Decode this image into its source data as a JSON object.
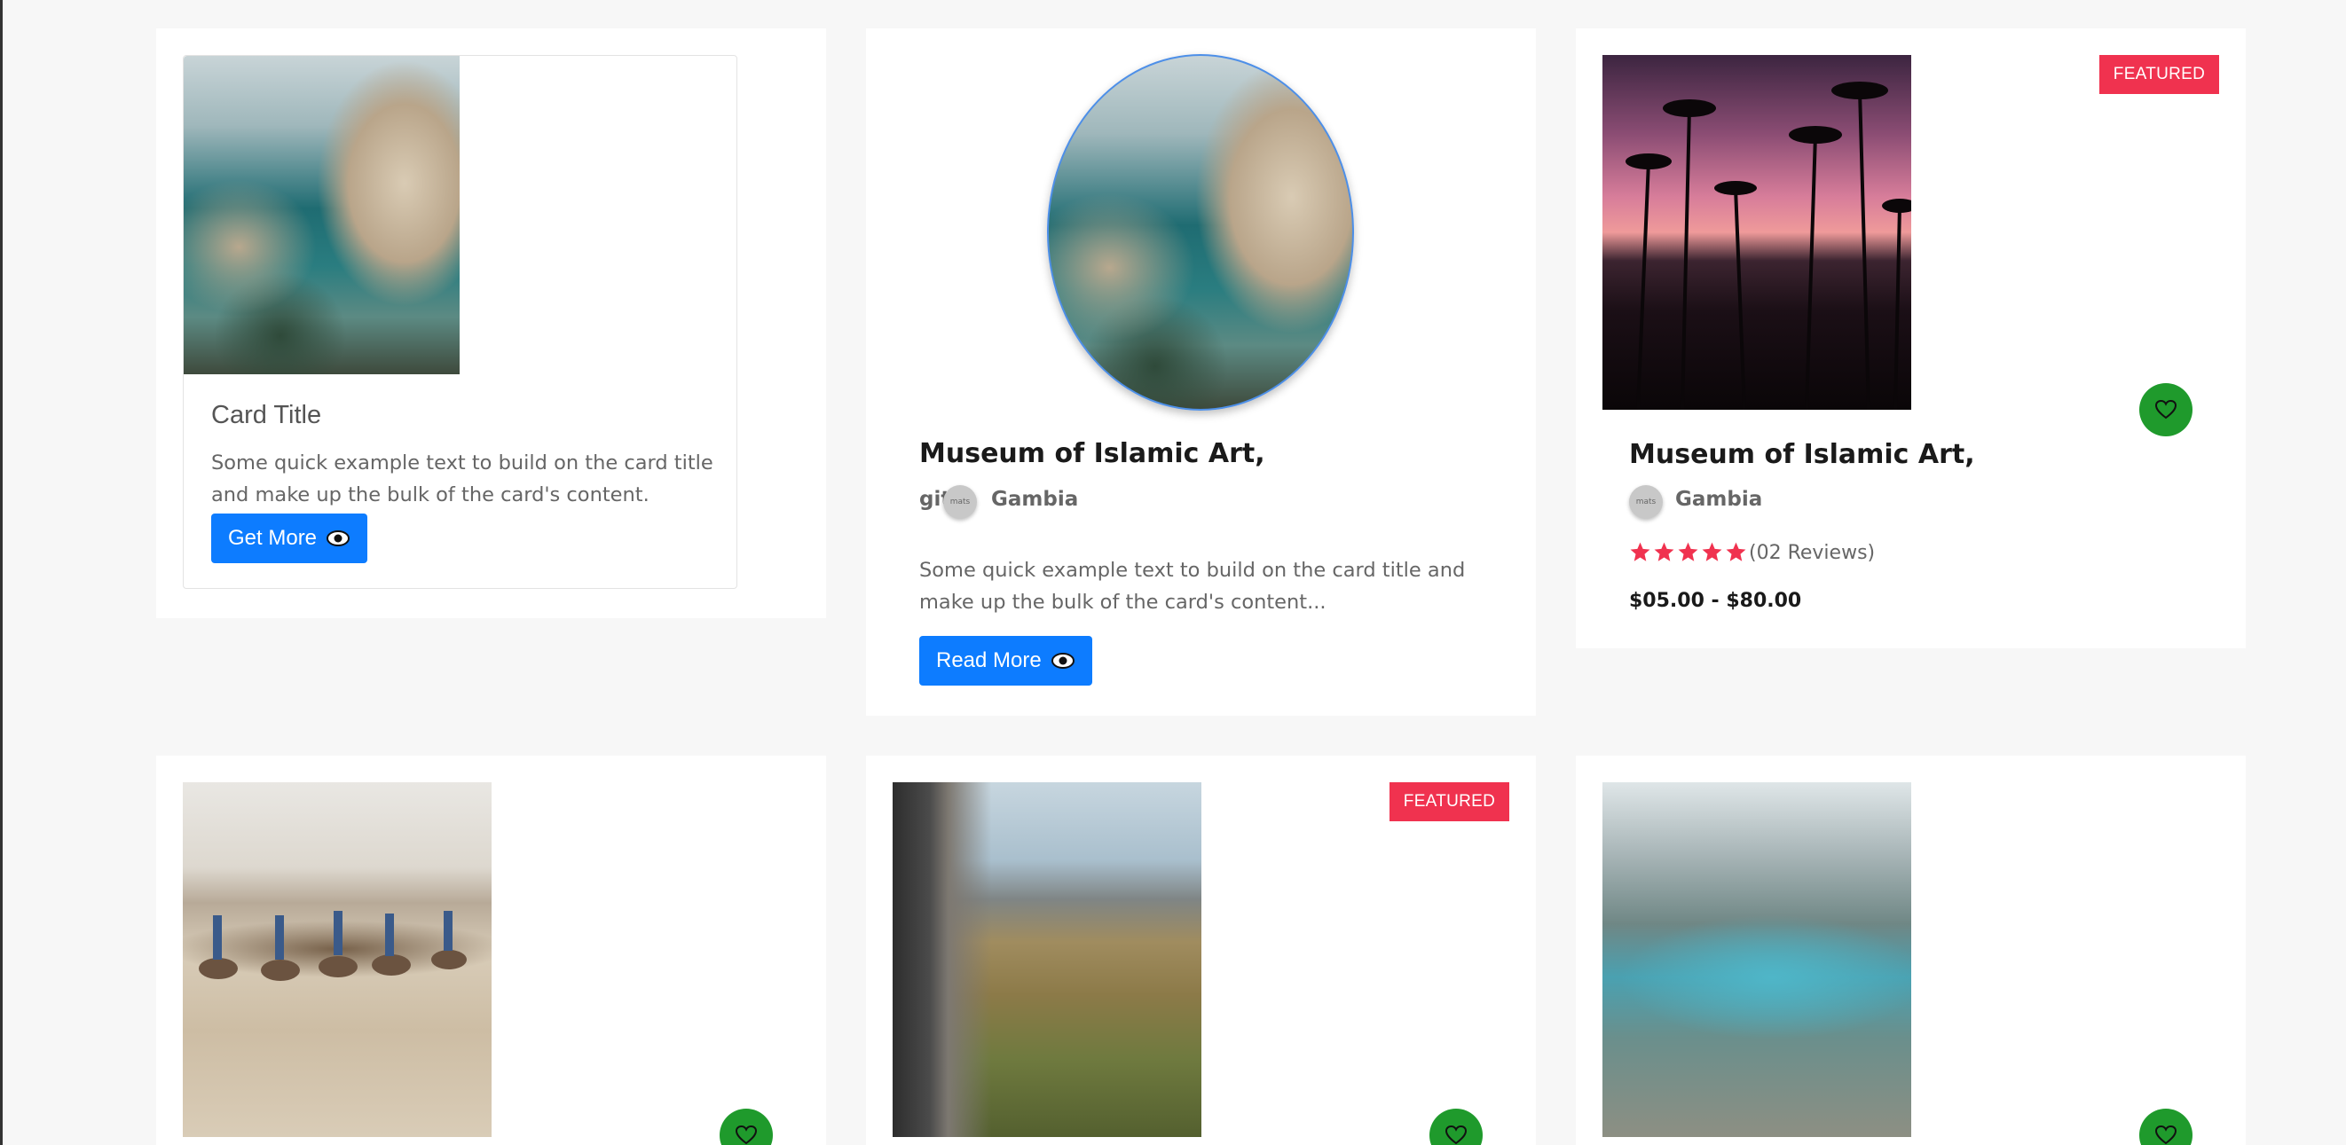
{
  "cards": {
    "basic": {
      "title": "Card Title",
      "text": "Some quick example text to build on the card title and make up the bulk of the card's content.",
      "button_label": "Get More"
    },
    "round": {
      "title": "Museum of Islamic Art,",
      "meta_prefix": "git",
      "avatar_alt": "mats",
      "location": "Gambia",
      "text": "Some quick example text to build on the card title and make up the bulk of the card's content...",
      "button_label": "Read More"
    },
    "featured": {
      "badge": "FEATURED",
      "title": "Museum of Islamic Art,",
      "avatar_alt": "mats",
      "location": "Gambia",
      "rating": 5,
      "reviews": "(02 Reviews)",
      "price": "$05.00 - $80.00"
    },
    "row2": [
      {
        "badge": ""
      },
      {
        "badge": "FEATURED"
      },
      {
        "badge": ""
      }
    ]
  },
  "colors": {
    "primary_button": "#0d7cff",
    "badge": "#f0324f",
    "heart_button": "#1f9a2c",
    "star": "#f0324f",
    "background": "#f7f7f7"
  },
  "icons": {
    "button": "eye-icon",
    "favorite": "heart-icon",
    "rating": "star-icon"
  }
}
